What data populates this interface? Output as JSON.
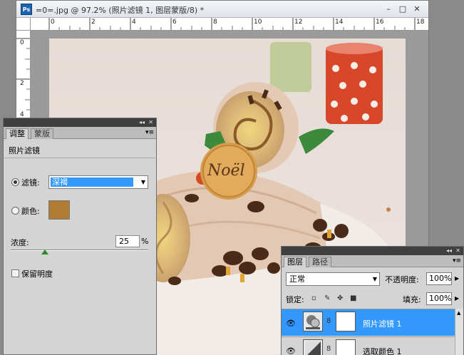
{
  "document": {
    "app_icon": "Ps",
    "title": "=0=.jpg @ 97.2% (照片滤镜 1, 图层蒙版/8) *",
    "window_buttons": [
      "–",
      "□",
      "✕"
    ],
    "ruler_h_labels": [
      "0",
      "2",
      "4",
      "6",
      "8",
      "10",
      "12",
      "14",
      "16",
      "18"
    ],
    "ruler_v_labels": [
      "0",
      "2",
      "4"
    ],
    "photo_text": "Noël"
  },
  "adjustments": {
    "collapse_label": "◂◂",
    "close_label": "✕",
    "tab_adjust": "调整",
    "tab_mask": "蒙版",
    "menu_label": "▾≡",
    "title": "照片滤镜",
    "filter_label": "滤镜:",
    "filter_value": "深褐",
    "color_label": "颜色:",
    "filter_color": "#b07c33",
    "density_label": "浓度:",
    "density_value": "25",
    "density_unit": "%",
    "density_level": 0.25,
    "preserve_label": "保留明度"
  },
  "layers": {
    "collapse_label": "◂◂",
    "close_label": "✕",
    "tab_layers": "图层",
    "tab_paths": "路径",
    "menu_label": "▾≡",
    "blend_mode": "正常",
    "opacity_label": "不透明度:",
    "opacity_value": "100%",
    "lock_label": "锁定:",
    "fill_label": "填充:",
    "fill_value": "100%",
    "rows": [
      {
        "name": "照片滤镜 1",
        "selected": true
      },
      {
        "name": "选取颜色 1",
        "selected": false
      }
    ]
  },
  "colors": {
    "selection": "#3399ff",
    "panel_bg": "#d4d4d4",
    "slider_thumb": "#2a8c2a"
  }
}
